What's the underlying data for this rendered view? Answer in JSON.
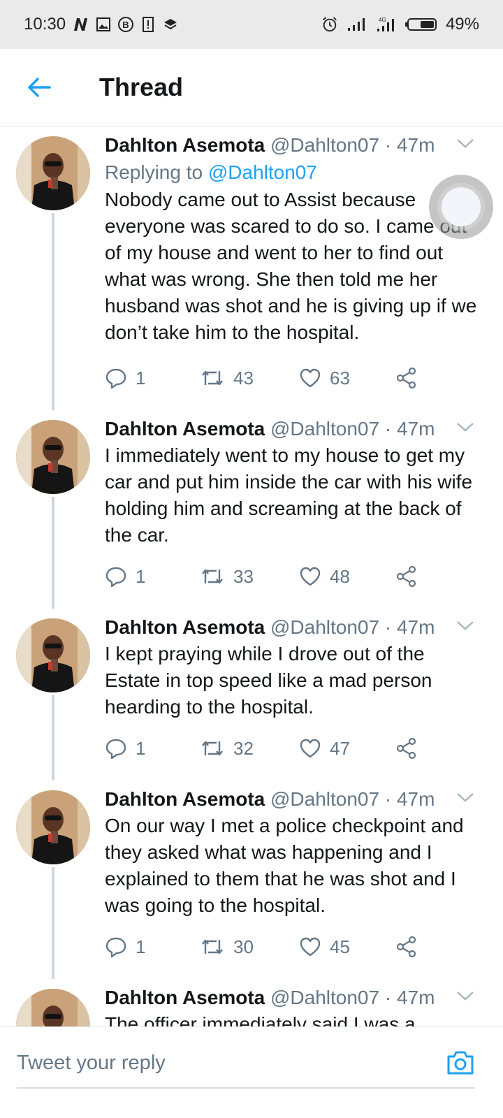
{
  "status_bar": {
    "time": "10:30",
    "battery": "49%",
    "left_icons": [
      "n-icon",
      "image-icon",
      "b-icon",
      "sim-icon",
      "layers-icon"
    ],
    "right_icons": [
      "alarm-icon",
      "signal-icon",
      "signal-4g-icon",
      "battery-icon"
    ]
  },
  "header": {
    "title": "Thread"
  },
  "tweets": [
    {
      "name": "Dahlton Asemota",
      "handle": "@Dahlton07",
      "time": "· 47m",
      "replying_label": "Replying to",
      "replying_to": "@Dahlton07",
      "text": "Nobody came out to Assist because everyone was scared to do so. I came out of my house and went to her to find out what was wrong. She then told me her husband was shot and he is giving up if we don’t take him to the hospital.",
      "replies": "1",
      "retweets": "43",
      "likes": "63"
    },
    {
      "name": "Dahlton Asemota",
      "handle": "@Dahlton07",
      "time": "· 47m",
      "text": "I immediately went to my house to get my car and put him inside the car with his wife holding him and screaming at the back of the car.",
      "replies": "1",
      "retweets": "33",
      "likes": "48"
    },
    {
      "name": "Dahlton Asemota",
      "handle": "@Dahlton07",
      "time": "· 47m",
      "text": "I kept praying while I drove out of the Estate in top speed like a mad person hearding to the hospital.",
      "replies": "1",
      "retweets": "32",
      "likes": "47"
    },
    {
      "name": "Dahlton Asemota",
      "handle": "@Dahlton07",
      "time": "· 47m",
      "text": "On our way I met a police checkpoint and they asked what was happening and I explained to them that he was shot and I was going to the hospital.",
      "replies": "1",
      "retweets": "30",
      "likes": "45"
    },
    {
      "name": "Dahlton Asemota",
      "handle": "@Dahlton07",
      "time": "· 47m",
      "text": "The officer immediately said I was a"
    }
  ],
  "reply_bar": {
    "placeholder": "Tweet your reply"
  },
  "colors": {
    "accent": "#1da1f2",
    "muted": "#657786",
    "text": "#14171a"
  }
}
